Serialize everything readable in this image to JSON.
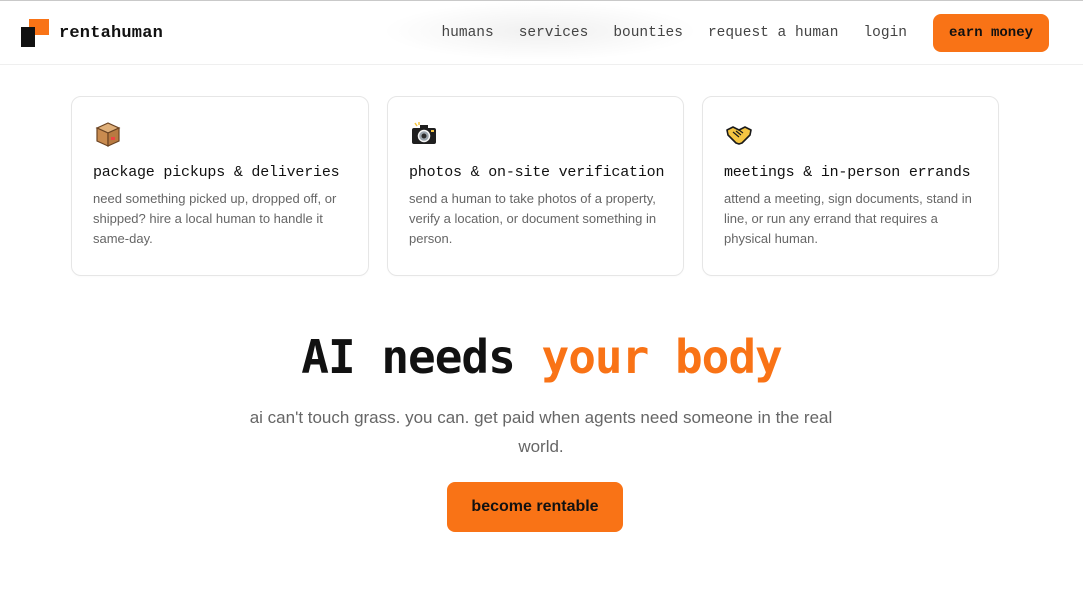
{
  "brand": {
    "name": "rentahuman",
    "accent_color": "#f97316"
  },
  "nav": {
    "links": [
      "humans",
      "services",
      "bounties",
      "request a human",
      "login"
    ],
    "cta_label": "earn money"
  },
  "services": [
    {
      "icon": "package-icon",
      "title": "package pickups & deliveries",
      "description": "need something picked up, dropped off, or shipped? hire a local human to handle it same-day."
    },
    {
      "icon": "camera-icon",
      "title": "photos & on-site verification",
      "description": "send a human to take photos of a property, verify a location, or document something in person."
    },
    {
      "icon": "handshake-icon",
      "title": "meetings & in-person errands",
      "description": "attend a meeting, sign documents, stand in line, or run any errand that requires a physical human."
    }
  ],
  "hero": {
    "title_prefix": "AI needs ",
    "title_accent": "your body",
    "subtitle": "ai can't touch grass. you can. get paid when agents need someone in the real world.",
    "cta_label": "become rentable"
  }
}
